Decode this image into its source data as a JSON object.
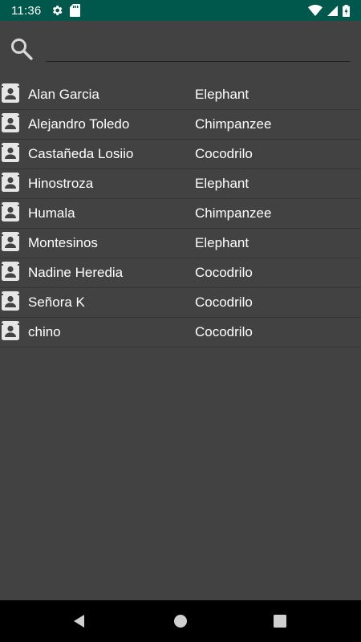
{
  "status_bar": {
    "time": "11:36",
    "icons": [
      "gear-icon",
      "sd-card-icon",
      "wifi-icon",
      "signal-icon",
      "battery-icon"
    ],
    "background_color": "#00574b"
  },
  "search": {
    "icon": "search-icon",
    "value": "",
    "placeholder": ""
  },
  "list": {
    "items": [
      {
        "name": "Alan Garcia",
        "animal": "Elephant",
        "icon": "contact-icon"
      },
      {
        "name": "Alejandro Toledo",
        "animal": "Chimpanzee",
        "icon": "contact-icon"
      },
      {
        "name": "Castañeda Losiio",
        "animal": "Cocodrilo",
        "icon": "contact-icon"
      },
      {
        "name": "Hinostroza",
        "animal": "Elephant",
        "icon": "contact-icon"
      },
      {
        "name": "Humala",
        "animal": "Chimpanzee",
        "icon": "contact-icon"
      },
      {
        "name": "Montesinos",
        "animal": "Elephant",
        "icon": "contact-icon"
      },
      {
        "name": "Nadine Heredia",
        "animal": "Cocodrilo",
        "icon": "contact-icon"
      },
      {
        "name": "Señora K",
        "animal": "Cocodrilo",
        "icon": "contact-icon"
      },
      {
        "name": "chino",
        "animal": "Cocodrilo",
        "icon": "contact-icon"
      }
    ]
  },
  "nav_bar": {
    "buttons": [
      "back-icon",
      "home-icon",
      "recents-icon"
    ]
  },
  "colors": {
    "background": "#424242",
    "text": "#ffffff",
    "nav_bar": "#000000"
  }
}
